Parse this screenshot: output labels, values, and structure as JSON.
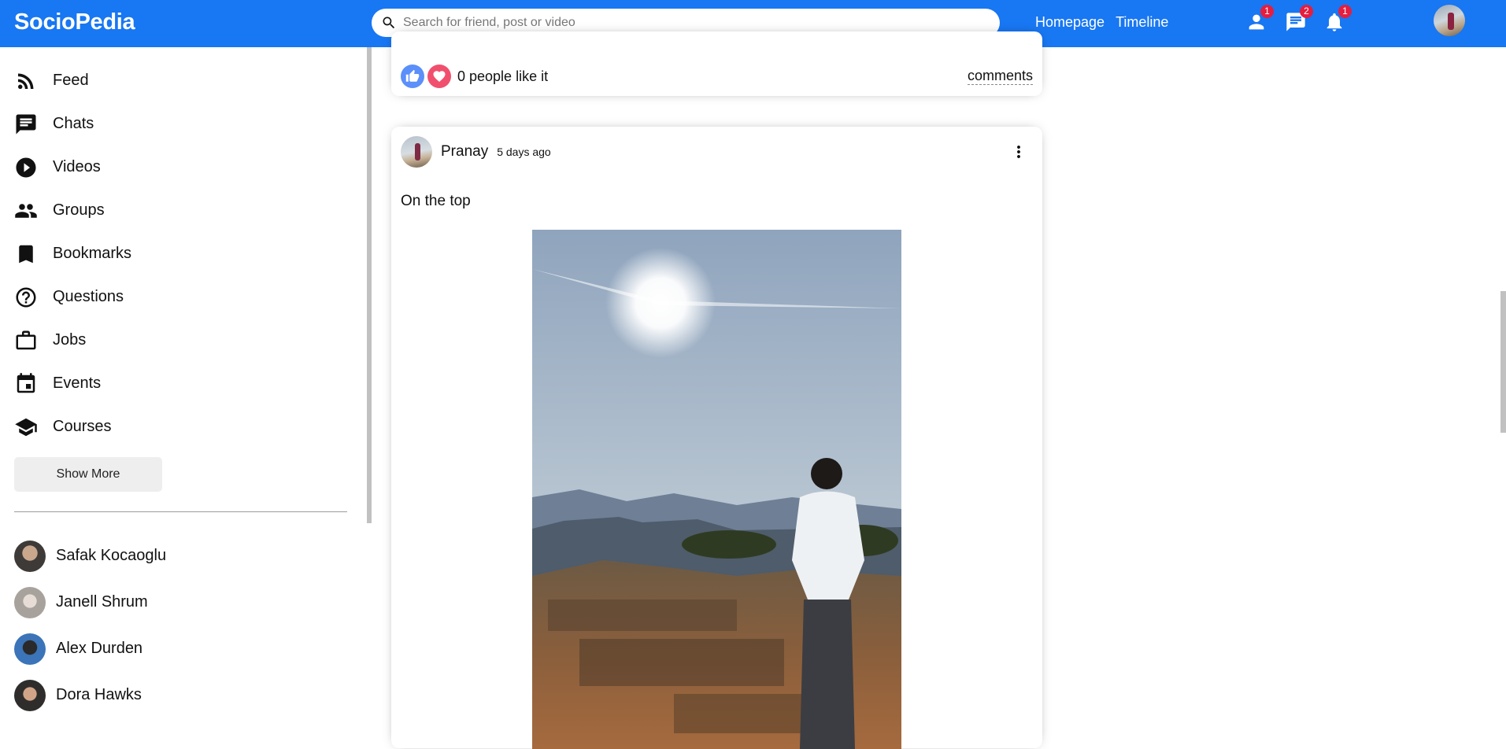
{
  "brand": {
    "logo": "SocioPedia",
    "color": "#1877f2"
  },
  "search": {
    "placeholder": "Search for friend, post or video"
  },
  "nav": {
    "links": [
      "Homepage",
      "Timeline"
    ]
  },
  "topbar_icons": [
    {
      "icon": "person-icon",
      "count": "1"
    },
    {
      "icon": "chat-icon",
      "count": "2"
    },
    {
      "icon": "notifications-icon",
      "count": "1"
    }
  ],
  "sidebar": {
    "items": [
      {
        "label": "Feed",
        "icon": "rss-feed-icon"
      },
      {
        "label": "Chats",
        "icon": "chat-icon"
      },
      {
        "label": "Videos",
        "icon": "play-circle-icon"
      },
      {
        "label": "Groups",
        "icon": "group-icon"
      },
      {
        "label": "Bookmarks",
        "icon": "bookmark-icon"
      },
      {
        "label": "Questions",
        "icon": "help-outline-icon"
      },
      {
        "label": "Jobs",
        "icon": "work-outline-icon"
      },
      {
        "label": "Events",
        "icon": "event-icon"
      },
      {
        "label": "Courses",
        "icon": "school-icon"
      }
    ],
    "show_more": "Show More",
    "friends": [
      "Safak Kocaoglu",
      "Janell Shrum",
      "Alex Durden",
      "Dora Hawks"
    ]
  },
  "previous_post": {
    "likes_text": "0 people like it",
    "comments_label": "comments"
  },
  "post": {
    "username": "Pranay",
    "date": "5 days ago",
    "text": "On the top"
  },
  "colors": {
    "like_blue": "#5b8ff9",
    "heart_red": "#f0506e",
    "badge_red": "#e41e3f"
  }
}
